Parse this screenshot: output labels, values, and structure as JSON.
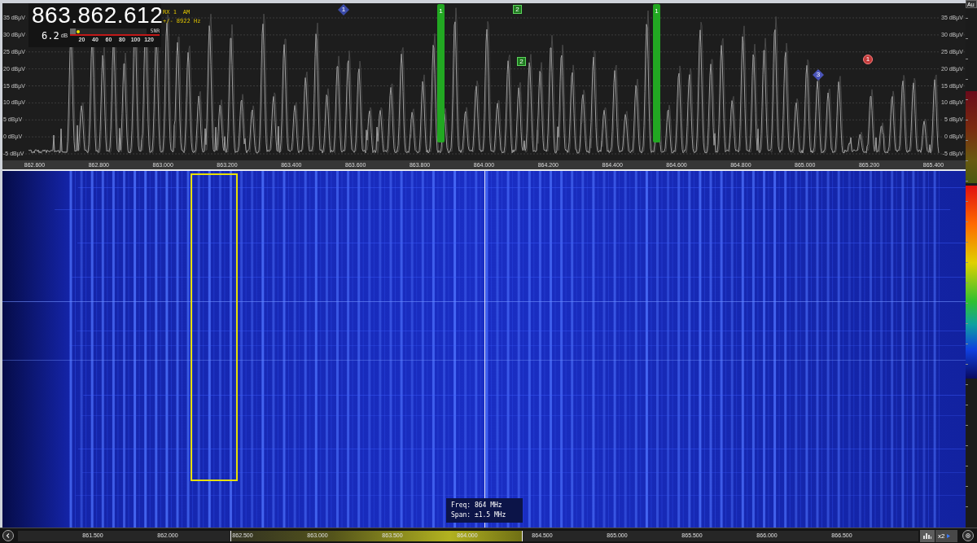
{
  "readout": {
    "frequency": "863.862.612",
    "receiver": "RX 1",
    "mode": "AM",
    "offset": "+/- 8922 Hz",
    "snr": "6.2",
    "snr_unit": "dB",
    "meter": {
      "label": "SNR",
      "level": 0.07,
      "scale": [
        "20",
        "40",
        "60",
        "80",
        "100",
        "120"
      ]
    }
  },
  "spectrum": {
    "y_labels_left": [
      "35 dBµV",
      "30 dBµV",
      "25 dBµV",
      "20 dBµV",
      "15 dBµV",
      "10 dBµV",
      "5 dBµV",
      "0 dBµV",
      "-5 dBµV"
    ],
    "y_labels_right": [
      "35 dBµV",
      "30 dBµV",
      "25 dBµV",
      "20 dBµV",
      "15 dBµV",
      "10 dBµV",
      "5 dBµV",
      "0 dBµV",
      "-5 dBµV"
    ],
    "markers": [
      {
        "kind": "diamond",
        "label": "1",
        "color": "#3a4aa8"
      },
      {
        "kind": "bar",
        "label": "1",
        "color": "#22a822"
      },
      {
        "kind": "square",
        "label": "2",
        "color": "#1f7a1f"
      },
      {
        "kind": "square",
        "label": "2",
        "color": "#1f7a1f"
      },
      {
        "kind": "bar",
        "label": "1",
        "color": "#22a822"
      },
      {
        "kind": "diamond",
        "label": "3",
        "color": "#4a54b8"
      },
      {
        "kind": "circle",
        "label": "1",
        "color": "#c03a3a"
      }
    ],
    "x_axis": [
      "862.600",
      "862.800",
      "863.000",
      "863.200",
      "863.400",
      "863.600",
      "863.800",
      "864.000",
      "864.200",
      "864.400",
      "864.600",
      "864.800",
      "865.000",
      "865.200",
      "865.400"
    ]
  },
  "waterfall": {
    "info": [
      "Freq: 864 MHz",
      "Span: ±1.5 MHz"
    ]
  },
  "colorbar": {
    "title": "Au"
  },
  "bottom_bar": {
    "scale": [
      "861.500",
      "862.000",
      "862.500",
      "863.000",
      "863.500",
      "864.000",
      "864.500",
      "865.000",
      "865.500",
      "866.000",
      "866.500"
    ],
    "zoom_factor": "x2"
  }
}
